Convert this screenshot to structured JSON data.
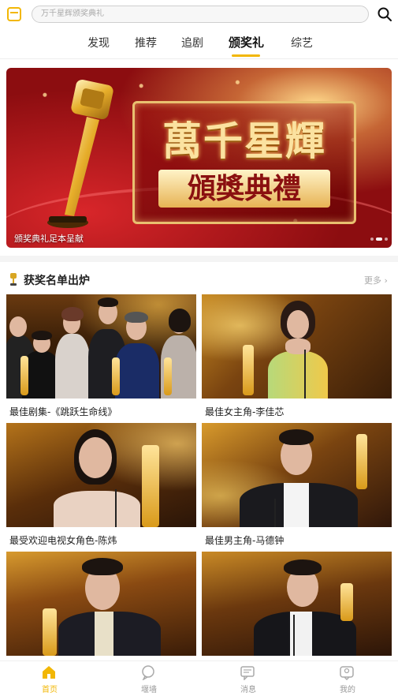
{
  "search": {
    "placeholder": "万千星辉颁奖典礼"
  },
  "tabs": [
    {
      "label": "发现"
    },
    {
      "label": "推荐"
    },
    {
      "label": "追剧"
    },
    {
      "label": "颁奖礼",
      "active": true
    },
    {
      "label": "综艺"
    }
  ],
  "banner": {
    "title_line1": "萬千星輝",
    "title_line2": "頒獎典禮",
    "caption": "颁奖典礼足本呈献"
  },
  "section": {
    "title": "获奖名单出炉",
    "more_label": "更多 ›"
  },
  "cards": [
    {
      "title": "最佳剧集-《跳跃生命线》"
    },
    {
      "title": "最佳女主角-李佳芯"
    },
    {
      "title": "最受欢迎电视女角色-陈炜"
    },
    {
      "title": "最佳男主角-马德钟"
    },
    {
      "title": ""
    },
    {
      "title": ""
    }
  ],
  "bottom_nav": [
    {
      "label": "首页",
      "icon": "home-icon",
      "active": true
    },
    {
      "label": "堰墙",
      "icon": "chat-bubble-icon"
    },
    {
      "label": "消息",
      "icon": "message-icon"
    },
    {
      "label": "我的",
      "icon": "profile-icon"
    }
  ],
  "colors": {
    "accent": "#f2b705",
    "banner_red": "#8c0d10",
    "gold": "#e7b354"
  }
}
